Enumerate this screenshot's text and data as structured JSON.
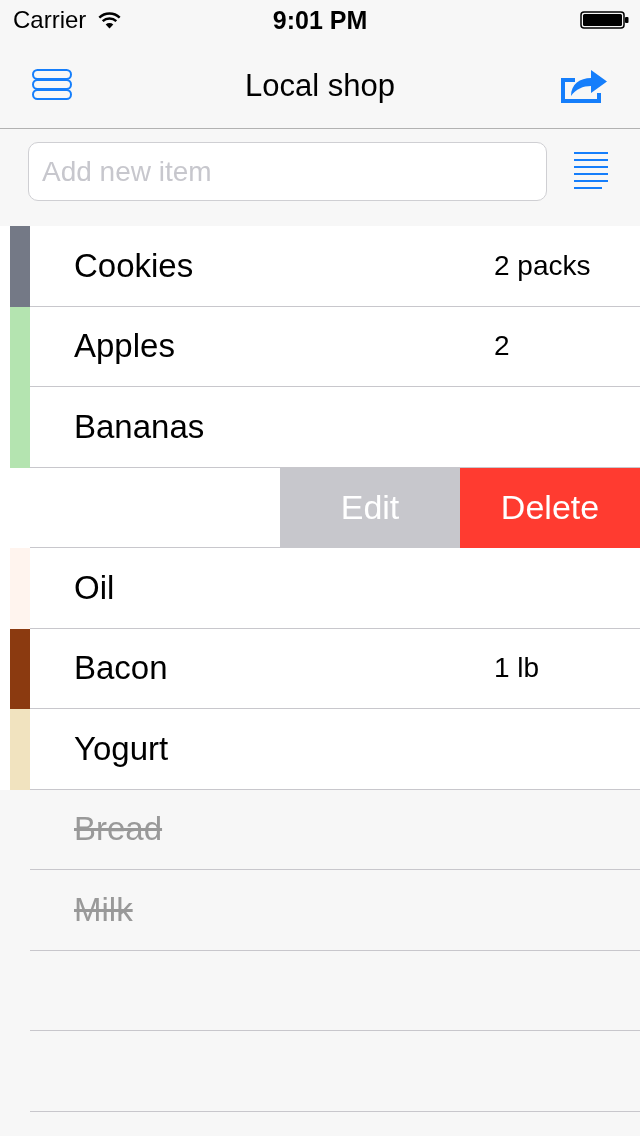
{
  "status_bar": {
    "carrier": "Carrier",
    "time": "9:01 PM"
  },
  "nav_bar": {
    "title": "Local shop"
  },
  "new_item": {
    "placeholder": "Add new item"
  },
  "items": [
    {
      "kind": "item",
      "name": "Cookies",
      "quantity": "2 packs",
      "color": "#747986",
      "checked": false
    },
    {
      "kind": "item",
      "name": "Apples",
      "quantity": "2",
      "color": "#b4e4b0",
      "checked": false
    },
    {
      "kind": "item",
      "name": "Bananas",
      "color": "#b4e4b0",
      "checked": false
    },
    {
      "kind": "swiped",
      "actions": [
        {
          "kind": "edit",
          "label": "Edit"
        },
        {
          "kind": "delete",
          "label": "Delete"
        }
      ]
    },
    {
      "kind": "item",
      "name": "Oil",
      "color": "#fff4ee",
      "checked": false
    },
    {
      "kind": "item",
      "name": "Bacon",
      "quantity": "1 lb",
      "color": "#8b3a10",
      "checked": false
    },
    {
      "kind": "item",
      "name": "Yogurt",
      "color": "#f1e3bf",
      "checked": false
    },
    {
      "kind": "item",
      "name": "Bread",
      "checked": true
    },
    {
      "kind": "item",
      "name": "Milk",
      "checked": true
    }
  ]
}
